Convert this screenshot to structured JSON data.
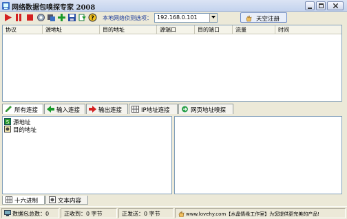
{
  "window": {
    "title": "网络数据包嗅探专家 2008"
  },
  "toolbar": {
    "buttons": [
      "start-icon",
      "pause-icon",
      "stop-icon",
      "settings-icon",
      "filter-icon",
      "add-icon",
      "save-icon",
      "export-icon",
      "help-icon"
    ],
    "local_nic_label": "本地网络侦测选项：",
    "local_ip": "192.168.0.101",
    "register_label": "天空注册"
  },
  "table": {
    "columns": [
      "协议",
      "源地址",
      "目的地址",
      "源端口",
      "目的端口",
      "流量",
      "时间"
    ],
    "rows": []
  },
  "tabs": [
    {
      "label": "所有连接",
      "active": true
    },
    {
      "label": "输入连接",
      "active": false
    },
    {
      "label": "输出连接",
      "active": false
    },
    {
      "label": "IP地址连接",
      "active": false
    },
    {
      "label": "网页地址嗅探",
      "active": false
    }
  ],
  "tree": {
    "source": "源地址",
    "dest": "目的地址"
  },
  "bottom_tabs": [
    {
      "label": "十六进制",
      "active": true
    },
    {
      "label": "文本内容",
      "active": false
    }
  ],
  "status": {
    "packets": "数据包总数：0",
    "received": "正收到：0 字节",
    "sent": "正发送：0 字节",
    "ad": "www.lovehy.com【水晶情缘工作室】为您提供更完美的产品!"
  },
  "colors": {
    "accent_blue": "#1a3a9a",
    "record_red": "#d42020",
    "add_green": "#1a9a2a"
  }
}
